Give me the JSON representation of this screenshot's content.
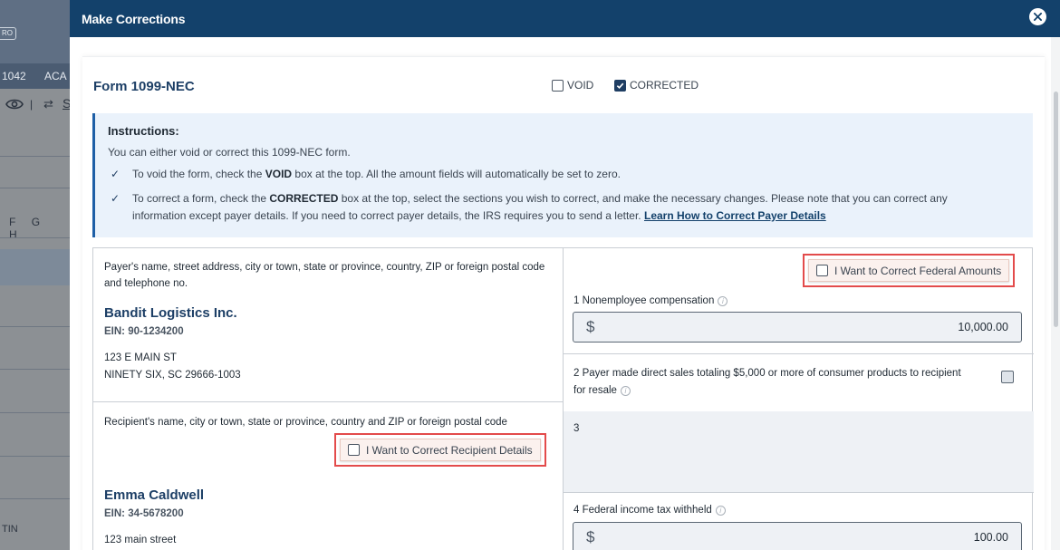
{
  "background": {
    "badge": "RO",
    "tabs": [
      "1042",
      "ACA"
    ],
    "columns": [
      "F",
      "G",
      "H"
    ],
    "tin_label": "TIN",
    "tool_link": "S"
  },
  "modal": {
    "title": "Make Corrections",
    "close_icon": "close-icon"
  },
  "form": {
    "title": "Form 1099-NEC",
    "void": {
      "label": "VOID",
      "checked": false
    },
    "corrected": {
      "label": "CORRECTED",
      "checked": true
    }
  },
  "instructions": {
    "title": "Instructions:",
    "intro": "You can either void or correct this 1099-NEC form.",
    "item1_pre": "To void the form, check the ",
    "item1_bold": "VOID",
    "item1_post": " box at the top. All the amount fields will automatically be set to zero.",
    "item2_pre": "To correct a form, check the ",
    "item2_bold": "CORRECTED",
    "item2_post": " box at the top, select the sections you wish to correct, and make the necessary changes. Please note that you can correct any information except payer details. If you need to correct payer details, the IRS requires you to send a letter. ",
    "link": "Learn How to Correct Payer Details"
  },
  "payer": {
    "label": "Payer's name, street address, city or town, state or province, country, ZIP or foreign postal code and telephone no.",
    "name": "Bandit Logistics Inc.",
    "ein": "EIN: 90-1234200",
    "address_line1": "123 E MAIN ST",
    "address_line2": "NINETY SIX, SC 29666-1003"
  },
  "recipient": {
    "label": "Recipient's name, city or town, state or province, country and ZIP or foreign postal code",
    "correct_label": "I Want to Correct Recipient Details",
    "name": "Emma Caldwell",
    "ein": "EIN: 34-5678200",
    "address_line1": "123 main street"
  },
  "federal": {
    "correct_label": "I Want to Correct Federal Amounts",
    "box1_label": "1  Nonemployee compensation",
    "box1_currency": "$",
    "box1_value": "10,000.00",
    "box2_label": "2  Payer made direct sales totaling $5,000 or more of consumer products to recipient for resale",
    "box3_label": "3",
    "box4_label": "4  Federal income tax withheld",
    "box4_currency": "$",
    "box4_value": "100.00"
  }
}
